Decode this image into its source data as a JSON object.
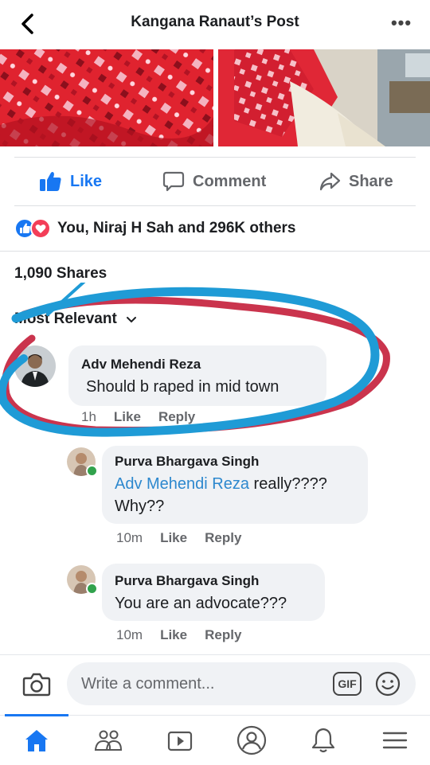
{
  "header": {
    "title": "Kangana Ranaut’s Post",
    "more_label": "•••"
  },
  "actions": {
    "like": "Like",
    "comment": "Comment",
    "share": "Share"
  },
  "reactions": {
    "text": "You, Niraj H Sah and 296K others"
  },
  "shares": {
    "text": "1,090 Shares"
  },
  "sort": {
    "label": "Most Relevant"
  },
  "comments": [
    {
      "author": "Adv Mehendi Reza",
      "text": "Should b raped in mid town",
      "time": "1h",
      "like": "Like",
      "reply": "Reply"
    },
    {
      "author": "Purva Bhargava Singh",
      "mention": "Adv Mehendi Reza",
      "text": " really????",
      "text2": "Why??",
      "time": "10m",
      "like": "Like",
      "reply": "Reply"
    },
    {
      "author": "Purva Bhargava Singh",
      "text": "You are an advocate???",
      "time": "10m",
      "like": "Like",
      "reply": "Reply"
    }
  ],
  "composer": {
    "placeholder": "Write a comment...",
    "gif_label": "GIF"
  },
  "nav": [
    "home-icon",
    "friends-icon",
    "watch-icon",
    "profile-icon",
    "notifications-icon",
    "menu-icon"
  ],
  "colors": {
    "accent": "#1877f2",
    "annotation_blue": "#1f9bd6",
    "annotation_red": "#c41e3a"
  }
}
